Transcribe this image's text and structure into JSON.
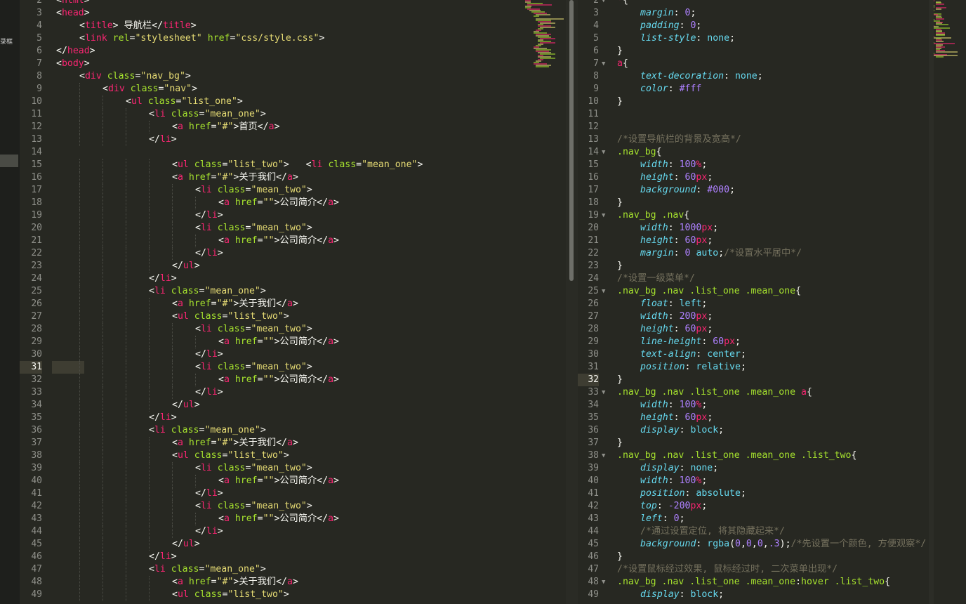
{
  "sidebar": {
    "stub_text": "录框"
  },
  "left_editor": {
    "current_line": 31,
    "lines": [
      {
        "n": "2",
        "indent": 0,
        "html": "<span class='p'>&lt;</span><span class='t'>html</span><span class='p'>&gt;</span>"
      },
      {
        "n": "3",
        "indent": 0,
        "html": "<span class='p'>&lt;</span><span class='t'>head</span><span class='p'>&gt;</span>"
      },
      {
        "n": "4",
        "indent": 1,
        "html": "<span class='p'>&lt;</span><span class='t'>title</span><span class='p'>&gt;</span> 导航栏<span class='p'>&lt;/</span><span class='t'>title</span><span class='p'>&gt;</span>"
      },
      {
        "n": "5",
        "indent": 1,
        "html": "<span class='p'>&lt;</span><span class='t'>link</span> <span class='at'>rel</span>=<span class='s'>\"stylesheet\"</span> <span class='at'>href</span>=<span class='s'>\"css/style.css\"</span><span class='p'>&gt;</span>"
      },
      {
        "n": "6",
        "indent": 0,
        "html": "<span class='p'>&lt;/</span><span class='t'>head</span><span class='p'>&gt;</span>"
      },
      {
        "n": "7",
        "indent": 0,
        "html": "<span class='p'>&lt;</span><span class='t'>body</span><span class='p'>&gt;</span>"
      },
      {
        "n": "8",
        "indent": 1,
        "html": "<span class='p'>&lt;</span><span class='t'>div</span> <span class='at'>class</span>=<span class='s'>\"nav_bg\"</span><span class='p'>&gt;</span>"
      },
      {
        "n": "9",
        "indent": 2,
        "html": "<span class='p'>&lt;</span><span class='t'>div</span> <span class='at'>class</span>=<span class='s'>\"nav\"</span><span class='p'>&gt;</span>"
      },
      {
        "n": "10",
        "indent": 3,
        "html": "<span class='p'>&lt;</span><span class='t'>ul</span> <span class='at'>class</span>=<span class='s'>\"list_one\"</span><span class='p'>&gt;</span>"
      },
      {
        "n": "11",
        "indent": 4,
        "html": "<span class='p'>&lt;</span><span class='t'>li</span> <span class='at'>class</span>=<span class='s'>\"mean_one\"</span><span class='p'>&gt;</span>"
      },
      {
        "n": "12",
        "indent": 5,
        "html": "<span class='p'>&lt;</span><span class='t'>a</span> <span class='at'>href</span>=<span class='s'>\"#\"</span><span class='p'>&gt;</span>首页<span class='p'>&lt;/</span><span class='t'>a</span><span class='p'>&gt;</span>"
      },
      {
        "n": "13",
        "indent": 4,
        "html": "<span class='p'>&lt;/</span><span class='t'>li</span><span class='p'>&gt;</span>"
      },
      {
        "n": "14",
        "indent": 0,
        "html": ""
      },
      {
        "n": "15",
        "indent": 5,
        "html": "<span class='p'>&lt;</span><span class='t'>ul</span> <span class='at'>class</span>=<span class='s'>\"list_two\"</span><span class='p'>&gt;</span>   <span class='p'>&lt;</span><span class='t'>li</span> <span class='at'>class</span>=<span class='s'>\"mean_one\"</span><span class='p'>&gt;</span>"
      },
      {
        "n": "16",
        "indent": 5,
        "html": "<span class='p'>&lt;</span><span class='t'>a</span> <span class='at'>href</span>=<span class='s'>\"#\"</span><span class='p'>&gt;</span>关于我们<span class='p'>&lt;/</span><span class='t'>a</span><span class='p'>&gt;</span>"
      },
      {
        "n": "17",
        "indent": 6,
        "html": "<span class='p'>&lt;</span><span class='t'>li</span> <span class='at'>class</span>=<span class='s'>\"mean_two\"</span><span class='p'>&gt;</span>"
      },
      {
        "n": "18",
        "indent": 7,
        "html": "<span class='p'>&lt;</span><span class='t'>a</span> <span class='at'>href</span>=<span class='s'>\"\"</span><span class='p'>&gt;</span>公司简介<span class='p'>&lt;/</span><span class='t'>a</span><span class='p'>&gt;</span>"
      },
      {
        "n": "19",
        "indent": 6,
        "html": "<span class='p'>&lt;/</span><span class='t'>li</span><span class='p'>&gt;</span>"
      },
      {
        "n": "20",
        "indent": 6,
        "html": "<span class='p'>&lt;</span><span class='t'>li</span> <span class='at'>class</span>=<span class='s'>\"mean_two\"</span><span class='p'>&gt;</span>"
      },
      {
        "n": "21",
        "indent": 7,
        "html": "<span class='p'>&lt;</span><span class='t'>a</span> <span class='at'>href</span>=<span class='s'>\"\"</span><span class='p'>&gt;</span>公司简介<span class='p'>&lt;/</span><span class='t'>a</span><span class='p'>&gt;</span>"
      },
      {
        "n": "22",
        "indent": 6,
        "html": "<span class='p'>&lt;/</span><span class='t'>li</span><span class='p'>&gt;</span>"
      },
      {
        "n": "23",
        "indent": 5,
        "html": "<span class='p'>&lt;/</span><span class='t'>ul</span><span class='p'>&gt;</span>"
      },
      {
        "n": "24",
        "indent": 4,
        "html": "<span class='p'>&lt;/</span><span class='t'>li</span><span class='p'>&gt;</span>"
      },
      {
        "n": "25",
        "indent": 4,
        "html": "<span class='p'>&lt;</span><span class='t'>li</span> <span class='at'>class</span>=<span class='s'>\"mean_one\"</span><span class='p'>&gt;</span>"
      },
      {
        "n": "26",
        "indent": 5,
        "html": "<span class='p'>&lt;</span><span class='t'>a</span> <span class='at'>href</span>=<span class='s'>\"#\"</span><span class='p'>&gt;</span>关于我们<span class='p'>&lt;/</span><span class='t'>a</span><span class='p'>&gt;</span>"
      },
      {
        "n": "27",
        "indent": 5,
        "html": "<span class='p'>&lt;</span><span class='t'>ul</span> <span class='at'>class</span>=<span class='s'>\"list_two\"</span><span class='p'>&gt;</span>"
      },
      {
        "n": "28",
        "indent": 6,
        "html": "<span class='p'>&lt;</span><span class='t'>li</span> <span class='at'>class</span>=<span class='s'>\"mean_two\"</span><span class='p'>&gt;</span>"
      },
      {
        "n": "29",
        "indent": 7,
        "html": "<span class='p'>&lt;</span><span class='t'>a</span> <span class='at'>href</span>=<span class='s'>\"\"</span><span class='p'>&gt;</span>公司简介<span class='p'>&lt;/</span><span class='t'>a</span><span class='p'>&gt;</span>"
      },
      {
        "n": "30",
        "indent": 6,
        "html": "<span class='p'>&lt;/</span><span class='t'>li</span><span class='p'>&gt;</span>"
      },
      {
        "n": "31",
        "indent": 6,
        "html": "<span class='p'>&lt;</span><span class='t'>li</span> <span class='at'>class</span>=<span class='s'>\"mean_two\"</span><span class='p'>&gt;</span>"
      },
      {
        "n": "32",
        "indent": 7,
        "html": "<span class='p'>&lt;</span><span class='t'>a</span> <span class='at'>href</span>=<span class='s'>\"\"</span><span class='p'>&gt;</span>公司简介<span class='p'>&lt;/</span><span class='t'>a</span><span class='p'>&gt;</span>"
      },
      {
        "n": "33",
        "indent": 6,
        "html": "<span class='p'>&lt;/</span><span class='t'>li</span><span class='p'>&gt;</span>"
      },
      {
        "n": "34",
        "indent": 5,
        "html": "<span class='p'>&lt;/</span><span class='t'>ul</span><span class='p'>&gt;</span>"
      },
      {
        "n": "35",
        "indent": 4,
        "html": "<span class='p'>&lt;/</span><span class='t'>li</span><span class='p'>&gt;</span>"
      },
      {
        "n": "36",
        "indent": 4,
        "html": "<span class='p'>&lt;</span><span class='t'>li</span> <span class='at'>class</span>=<span class='s'>\"mean_one\"</span><span class='p'>&gt;</span>"
      },
      {
        "n": "37",
        "indent": 5,
        "html": "<span class='p'>&lt;</span><span class='t'>a</span> <span class='at'>href</span>=<span class='s'>\"#\"</span><span class='p'>&gt;</span>关于我们<span class='p'>&lt;/</span><span class='t'>a</span><span class='p'>&gt;</span>"
      },
      {
        "n": "38",
        "indent": 5,
        "html": "<span class='p'>&lt;</span><span class='t'>ul</span> <span class='at'>class</span>=<span class='s'>\"list_two\"</span><span class='p'>&gt;</span>"
      },
      {
        "n": "39",
        "indent": 6,
        "html": "<span class='p'>&lt;</span><span class='t'>li</span> <span class='at'>class</span>=<span class='s'>\"mean_two\"</span><span class='p'>&gt;</span>"
      },
      {
        "n": "40",
        "indent": 7,
        "html": "<span class='p'>&lt;</span><span class='t'>a</span> <span class='at'>href</span>=<span class='s'>\"\"</span><span class='p'>&gt;</span>公司简介<span class='p'>&lt;/</span><span class='t'>a</span><span class='p'>&gt;</span>"
      },
      {
        "n": "41",
        "indent": 6,
        "html": "<span class='p'>&lt;/</span><span class='t'>li</span><span class='p'>&gt;</span>"
      },
      {
        "n": "42",
        "indent": 6,
        "html": "<span class='p'>&lt;</span><span class='t'>li</span> <span class='at'>class</span>=<span class='s'>\"mean_two\"</span><span class='p'>&gt;</span>"
      },
      {
        "n": "43",
        "indent": 7,
        "html": "<span class='p'>&lt;</span><span class='t'>a</span> <span class='at'>href</span>=<span class='s'>\"\"</span><span class='p'>&gt;</span>公司简介<span class='p'>&lt;/</span><span class='t'>a</span><span class='p'>&gt;</span>"
      },
      {
        "n": "44",
        "indent": 6,
        "html": "<span class='p'>&lt;/</span><span class='t'>li</span><span class='p'>&gt;</span>"
      },
      {
        "n": "45",
        "indent": 5,
        "html": "<span class='p'>&lt;/</span><span class='t'>ul</span><span class='p'>&gt;</span>"
      },
      {
        "n": "46",
        "indent": 4,
        "html": "<span class='p'>&lt;/</span><span class='t'>li</span><span class='p'>&gt;</span>"
      },
      {
        "n": "47",
        "indent": 4,
        "html": "<span class='p'>&lt;</span><span class='t'>li</span> <span class='at'>class</span>=<span class='s'>\"mean_one\"</span><span class='p'>&gt;</span>"
      },
      {
        "n": "48",
        "indent": 5,
        "html": "<span class='p'>&lt;</span><span class='t'>a</span> <span class='at'>href</span>=<span class='s'>\"#\"</span><span class='p'>&gt;</span>关于我们<span class='p'>&lt;/</span><span class='t'>a</span><span class='p'>&gt;</span>"
      },
      {
        "n": "49",
        "indent": 5,
        "html": "<span class='p'>&lt;</span><span class='t'>ul</span> <span class='at'>class</span>=<span class='s'>\"list_two\"</span><span class='p'>&gt;</span>"
      }
    ]
  },
  "right_editor": {
    "current_line": 32,
    "lines": [
      {
        "n": "2",
        "fold": true,
        "indent": 0,
        "html": "<span class='t'>*</span>{"
      },
      {
        "n": "3",
        "indent": 1,
        "html": "<span class='pr'>margin</span>: <span class='n'>0</span>;"
      },
      {
        "n": "4",
        "indent": 1,
        "html": "<span class='pr'>padding</span>: <span class='n'>0</span>;"
      },
      {
        "n": "5",
        "indent": 1,
        "html": "<span class='pr'>list-style</span>: <span class='v'>none</span>;"
      },
      {
        "n": "6",
        "indent": 0,
        "html": "}"
      },
      {
        "n": "7",
        "fold": true,
        "indent": 0,
        "html": "<span class='t'>a</span>{"
      },
      {
        "n": "8",
        "indent": 1,
        "html": "<span class='pr'>text-decoration</span>: <span class='v'>none</span>;"
      },
      {
        "n": "9",
        "indent": 1,
        "html": "<span class='pr'>color</span>: <span class='n'>#fff</span>"
      },
      {
        "n": "10",
        "indent": 0,
        "html": "}"
      },
      {
        "n": "11",
        "indent": 0,
        "html": ""
      },
      {
        "n": "12",
        "indent": 0,
        "html": ""
      },
      {
        "n": "13",
        "indent": 0,
        "html": "<span class='c'>/*设置导航栏的背景及宽高*/</span>"
      },
      {
        "n": "14",
        "fold": true,
        "indent": 0,
        "html": "<span class='sel-c'>.nav_bg</span>{"
      },
      {
        "n": "15",
        "indent": 1,
        "html": "<span class='pr'>width</span>: <span class='n'>100</span><span class='u'>%</span>;"
      },
      {
        "n": "16",
        "indent": 1,
        "html": "<span class='pr'>height</span>: <span class='n'>60</span><span class='u'>px</span>;"
      },
      {
        "n": "17",
        "indent": 1,
        "html": "<span class='pr'>background</span>: <span class='n'>#000</span>;"
      },
      {
        "n": "18",
        "indent": 0,
        "html": "}"
      },
      {
        "n": "19",
        "fold": true,
        "indent": 0,
        "html": "<span class='sel-c'>.nav_bg .nav</span>{"
      },
      {
        "n": "20",
        "indent": 1,
        "html": "<span class='pr'>width</span>: <span class='n'>1000</span><span class='u'>px</span>;"
      },
      {
        "n": "21",
        "indent": 1,
        "html": "<span class='pr'>height</span>: <span class='n'>60</span><span class='u'>px</span>;"
      },
      {
        "n": "22",
        "indent": 1,
        "html": "<span class='pr'>margin</span>: <span class='n'>0</span> <span class='v'>auto</span>;<span class='c'>/*设置水平居中*/</span>"
      },
      {
        "n": "23",
        "indent": 0,
        "html": "}"
      },
      {
        "n": "24",
        "indent": 0,
        "html": "<span class='c'>/*设置一级菜单*/</span>"
      },
      {
        "n": "25",
        "fold": true,
        "indent": 0,
        "html": "<span class='sel-c'>.nav_bg .nav .list_one .mean_one</span>{"
      },
      {
        "n": "26",
        "indent": 1,
        "html": "<span class='pr'>float</span>: <span class='v'>left</span>;"
      },
      {
        "n": "27",
        "indent": 1,
        "html": "<span class='pr'>width</span>: <span class='n'>200</span><span class='u'>px</span>;"
      },
      {
        "n": "28",
        "indent": 1,
        "html": "<span class='pr'>height</span>: <span class='n'>60</span><span class='u'>px</span>;"
      },
      {
        "n": "29",
        "indent": 1,
        "html": "<span class='pr'>line-height</span>: <span class='n'>60</span><span class='u'>px</span>;"
      },
      {
        "n": "30",
        "indent": 1,
        "html": "<span class='pr'>text-align</span>: <span class='v'>center</span>;"
      },
      {
        "n": "31",
        "indent": 1,
        "html": "<span class='pr'>position</span>: <span class='v'>relative</span>;"
      },
      {
        "n": "32",
        "indent": 0,
        "html": "}"
      },
      {
        "n": "33",
        "fold": true,
        "indent": 0,
        "html": "<span class='sel-c'>.nav_bg .nav .list_one .mean_one </span><span class='t'>a</span>{"
      },
      {
        "n": "34",
        "indent": 1,
        "html": "<span class='pr'>width</span>: <span class='n'>100</span><span class='u'>%</span>;"
      },
      {
        "n": "35",
        "indent": 1,
        "html": "<span class='pr'>height</span>: <span class='n'>60</span><span class='u'>px</span>;"
      },
      {
        "n": "36",
        "indent": 1,
        "html": "<span class='pr'>display</span>: <span class='v'>block</span>;"
      },
      {
        "n": "37",
        "indent": 0,
        "html": "}"
      },
      {
        "n": "38",
        "fold": true,
        "indent": 0,
        "html": "<span class='sel-c'>.nav_bg .nav .list_one .mean_one .list_two</span>{"
      },
      {
        "n": "39",
        "indent": 1,
        "html": "<span class='pr'>display</span>: <span class='v'>none</span>;"
      },
      {
        "n": "40",
        "indent": 1,
        "html": "<span class='pr'>width</span>: <span class='n'>100</span><span class='u'>%</span>;"
      },
      {
        "n": "41",
        "indent": 1,
        "html": "<span class='pr'>position</span>: <span class='v'>absolute</span>;"
      },
      {
        "n": "42",
        "indent": 1,
        "html": "<span class='pr'>top</span>: <span class='n'>-200</span><span class='u'>px</span>;"
      },
      {
        "n": "43",
        "indent": 1,
        "html": "<span class='pr'>left</span>: <span class='n'>0</span>;"
      },
      {
        "n": "44",
        "indent": 1,
        "html": "<span class='c'>/*通过设置定位, 将其隐藏起来*/</span>"
      },
      {
        "n": "45",
        "indent": 1,
        "html": "<span class='pr'>background</span>: <span class='v'>rgba</span>(<span class='n'>0</span>,<span class='n'>0</span>,<span class='n'>0</span>,<span class='n'>.3</span>);<span class='c'>/*先设置一个颜色, 方便观察*/</span>"
      },
      {
        "n": "46",
        "indent": 0,
        "html": "}"
      },
      {
        "n": "47",
        "indent": 0,
        "html": "<span class='c'>/*设置鼠标经过效果, 鼠标经过时, 二次菜单出现*/</span>"
      },
      {
        "n": "48",
        "fold": true,
        "indent": 0,
        "html": "<span class='sel-c'>.nav_bg .nav .list_one .mean_one</span>:<span class='sel-c'>hover .list_two</span>{"
      },
      {
        "n": "49",
        "indent": 1,
        "html": "<span class='pr'>display</span>: <span class='v'>block</span>;"
      }
    ]
  },
  "colors": {
    "bg": "#272822",
    "tag": "#f92672",
    "attr": "#a6e22e",
    "string": "#e6db74",
    "comment": "#75715e",
    "number": "#ae81ff",
    "keyword": "#66d9ef"
  }
}
